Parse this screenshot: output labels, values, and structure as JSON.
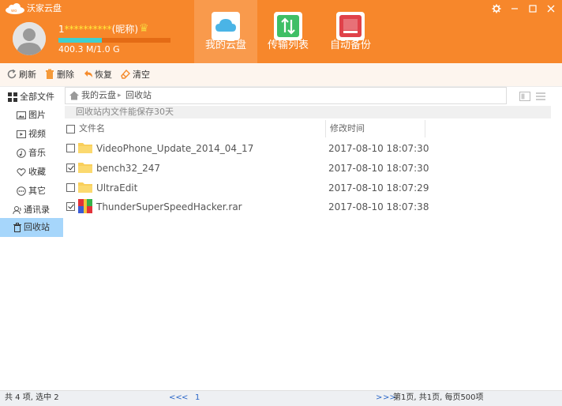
{
  "app": {
    "title": "沃家云盘"
  },
  "window_controls": {
    "settings_icon": "gear-icon",
    "minimize_icon": "minimize-icon",
    "maximize_icon": "maximize-icon",
    "close_icon": "close-icon"
  },
  "user": {
    "name_prefix": "1",
    "name_masked": "**********",
    "nickname": "(昵称)",
    "quota_text": "400.3 M/1.0 G",
    "quota_fraction": 0.39
  },
  "nav_tabs": [
    {
      "label": "我的云盘",
      "icon": "cloud-icon",
      "active": true
    },
    {
      "label": "传输列表",
      "icon": "transfer-icon",
      "active": false
    },
    {
      "label": "自动备份",
      "icon": "backup-icon",
      "active": false
    }
  ],
  "toolbar": {
    "refresh": "刷新",
    "delete": "删除",
    "restore": "恢复",
    "clear": "清空"
  },
  "sidebar": {
    "items": [
      {
        "label": "全部文件",
        "icon": "grid-icon"
      },
      {
        "label": "图片",
        "icon": "image-icon"
      },
      {
        "label": "视频",
        "icon": "video-icon"
      },
      {
        "label": "音乐",
        "icon": "music-icon"
      },
      {
        "label": "收藏",
        "icon": "heart-icon"
      },
      {
        "label": "其它",
        "icon": "more-icon"
      },
      {
        "label": "通讯录",
        "icon": "contacts-icon"
      },
      {
        "label": "回收站",
        "icon": "trash-icon",
        "active": true
      }
    ]
  },
  "breadcrumb": {
    "root": "我的云盘",
    "separator": "▸",
    "current": "回收站"
  },
  "notice": "回收站内文件能保存30天",
  "table": {
    "columns": {
      "name": "文件名",
      "time": "修改时间"
    },
    "rows": [
      {
        "name": "VideoPhone_Update_2014_04_17",
        "time": "2017-08-10 18:07:30",
        "type": "folder",
        "checked": false
      },
      {
        "name": "bench32_247",
        "time": "2017-08-10 18:07:30",
        "type": "folder",
        "checked": true
      },
      {
        "name": "UltraEdit",
        "time": "2017-08-10 18:07:29",
        "type": "folder",
        "checked": false
      },
      {
        "name": "ThunderSuperSpeedHacker.rar",
        "time": "2017-08-10 18:07:38",
        "type": "archive",
        "checked": true
      }
    ]
  },
  "status": {
    "summary": "共 4 项, 选中 2",
    "first_page": "<<",
    "prev_page": "<",
    "current_page": "1",
    "next_page": ">",
    "last_page": ">>",
    "page_info": "第1页, 共1页, 每页500项"
  },
  "colors": {
    "header": "#f7872b",
    "accent_active_tab": "#f99a4c",
    "sidebar_active": "#a6d6fb",
    "quota_fill": "#3ed0cf",
    "folder": "#f9cf5b",
    "link": "#2a66c7"
  }
}
